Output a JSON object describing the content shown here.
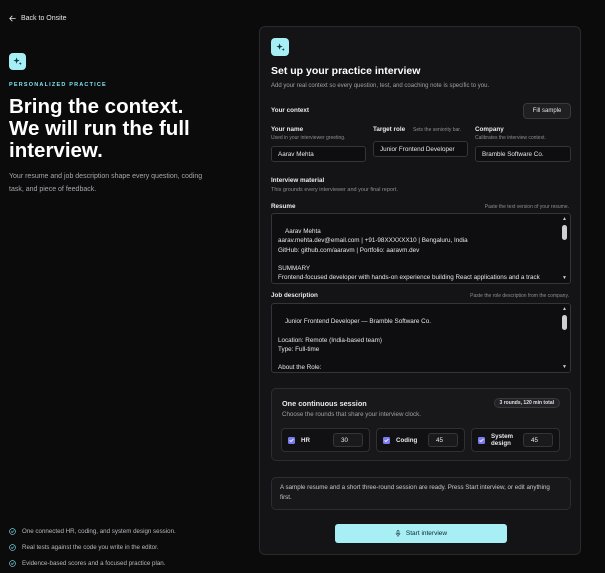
{
  "nav": {
    "back_label": "Back to Onsite"
  },
  "hero": {
    "eyebrow": "PERSONALIZED PRACTICE",
    "headline_lines": [
      "Bring the context.",
      "We will run the full",
      "interview."
    ],
    "lead": "Your resume and job description shape every question, coding task, and piece of feedback."
  },
  "features": [
    "One connected HR, coding, and system design session.",
    "Real tests against the code you write in the editor.",
    "Evidence-based scores and a focused practice plan."
  ],
  "panel": {
    "title": "Set up your practice interview",
    "subtitle": "Add your real context so every question, test, and coaching note is specific to you.",
    "context": {
      "title": "Your context",
      "fill_sample_label": "Fill sample",
      "name": {
        "label": "Your name",
        "hint": "Used in your interviewer greeting.",
        "value": "Aarav Mehta"
      },
      "role": {
        "label": "Target role",
        "hint": "Sets the seniority bar.",
        "value": "Junior Frontend Developer"
      },
      "company": {
        "label": "Company",
        "hint": "Calibrates the interview context.",
        "value": "Bramble Software Co."
      }
    },
    "material": {
      "title": "Interview material",
      "subtitle": "This grounds every interviewer and your final report.",
      "resume": {
        "label": "Resume",
        "hint": "Paste the text version of your resume.",
        "value": "Aarav Mehta\naarav.mehta.dev@email.com | +91-98XXXXXX10 | Bengaluru, India\nGitHub: github.com/aaravm | Portfolio: aaravm.dev\n\nSUMMARY\nFrontend-focused developer with hands-on experience building React applications and a track record of shipping projects fast in hackathon settings."
      },
      "jd": {
        "label": "Job description",
        "hint": "Paste the role description from the company.",
        "value": "Junior Frontend Developer — Bramble Software Co.\n\nLocation: Remote (India-based team)\nType: Full-time\n\nAbout the Role:\nWe're looking for a Junior Frontend Developer to join our small product team building tools for local businesses. You'll work closely with our design and backend teams to ship features fast."
      }
    },
    "session": {
      "title": "One continuous session",
      "subtitle": "Choose the rounds that share your interview clock.",
      "badge": "3 rounds, 120 min total",
      "rounds": [
        {
          "label": "HR",
          "minutes": "30",
          "checked": true
        },
        {
          "label": "Coding",
          "minutes": "45",
          "checked": true
        },
        {
          "label": "System design",
          "minutes": "45",
          "checked": true
        }
      ]
    },
    "notice": "A sample resume and a short three-round session are ready. Press Start interview, or edit anything first.",
    "start_label": "Start interview"
  },
  "colors": {
    "accent": "#a8eef5",
    "eyebrow": "#7fe3ee",
    "check": "#7b7bf0",
    "background": "#0b0b0c",
    "panel": "#141416"
  },
  "icons": {
    "back": "arrow-left-icon",
    "logo": "sparkle-icon",
    "bullet": "check-circle-icon",
    "start": "microphone-icon"
  }
}
